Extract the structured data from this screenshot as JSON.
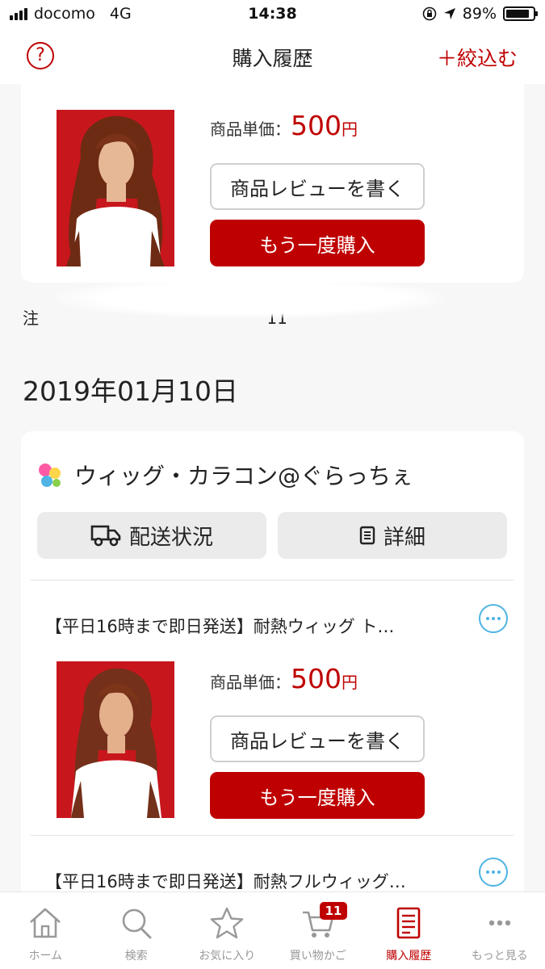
{
  "status_bar": {
    "carrier": "docomo",
    "network": "4G",
    "time": "14:38",
    "battery": "89%",
    "battery_level": 0.89
  },
  "nav": {
    "help_label": "?",
    "title": "購入履歴",
    "filter_label": "＋絞込む"
  },
  "order_top": {
    "price_label": "商品単価：",
    "price": "500",
    "price_unit": "円",
    "review_label": "商品レビューを書く",
    "rebuy_label": "もう一度購入",
    "order_number_prefix": "注",
    "order_number_partial": "11"
  },
  "date_heading": "2019年01月10日",
  "shop": {
    "name": "ウィッグ・カラコン@ぐらっちぇ",
    "delivery_label": "配送状況",
    "detail_label": "詳細"
  },
  "items": [
    {
      "title": "【平日16時まで即日発送】耐熱ウィッグ ト…",
      "price_label": "商品単価：",
      "price": "500",
      "price_unit": "円",
      "review_label": "商品レビューを書く",
      "rebuy_label": "もう一度購入"
    },
    {
      "title": "【平日16時まで即日発送】耐熱フルウィッグ…"
    }
  ],
  "tabs": [
    {
      "label": "ホーム",
      "icon": "home-icon"
    },
    {
      "label": "検索",
      "icon": "search-icon"
    },
    {
      "label": "お気に入り",
      "icon": "star-icon"
    },
    {
      "label": "買い物かご",
      "icon": "cart-icon",
      "badge": "11"
    },
    {
      "label": "購入履歴",
      "icon": "receipt-icon",
      "active": true
    },
    {
      "label": "もっと見る",
      "icon": "more-icon"
    }
  ],
  "colors": {
    "brand_red": "#bf0000",
    "info_blue": "#4fb4e3"
  }
}
